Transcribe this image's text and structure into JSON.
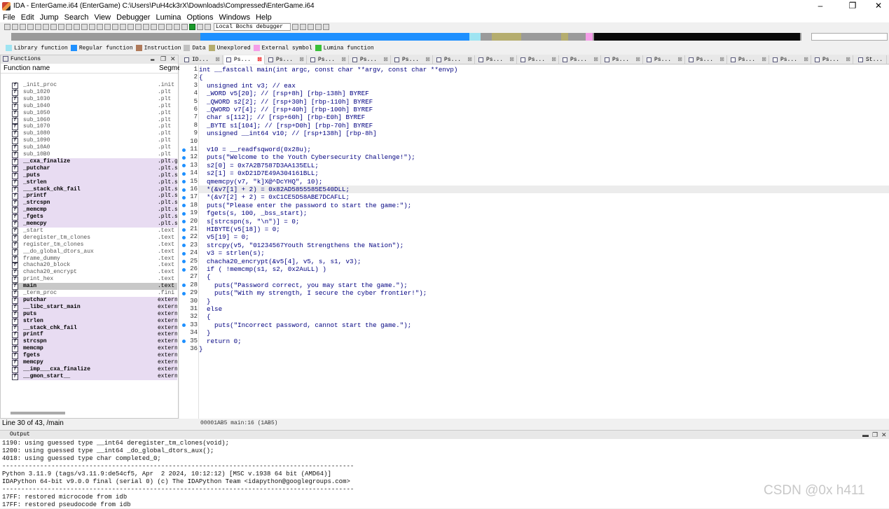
{
  "window": {
    "title": "IDA - EnterGame.i64 (EnterGame) C:\\Users\\PuH4ck3rX\\Downloads\\Compressed\\EnterGame.i64"
  },
  "menu": [
    "File",
    "Edit",
    "Jump",
    "Search",
    "View",
    "Debugger",
    "Lumina",
    "Options",
    "Windows",
    "Help"
  ],
  "toolbar": {
    "debugger": "Local Bochs debugger"
  },
  "legend": [
    {
      "label": "Library function",
      "color": "#9ee4f2"
    },
    {
      "label": "Regular function",
      "color": "#1e90ff"
    },
    {
      "label": "Instruction",
      "color": "#b07a5a"
    },
    {
      "label": "Data",
      "color": "#c0c0c0"
    },
    {
      "label": "Unexplored",
      "color": "#b5ad6e"
    },
    {
      "label": "External symbol",
      "color": "#f59ee8"
    },
    {
      "label": "Lumina function",
      "color": "#39c039"
    }
  ],
  "functions": {
    "title": "Functions",
    "col_name": "Function name",
    "col_segment": "Segme",
    "rows": [
      {
        "name": "_init_proc",
        "seg": ".init",
        "kind": "reg"
      },
      {
        "name": "sub_1020",
        "seg": ".plt",
        "kind": "reg"
      },
      {
        "name": "sub_1030",
        "seg": ".plt",
        "kind": "reg"
      },
      {
        "name": "sub_1040",
        "seg": ".plt",
        "kind": "reg"
      },
      {
        "name": "sub_1050",
        "seg": ".plt",
        "kind": "reg"
      },
      {
        "name": "sub_1060",
        "seg": ".plt",
        "kind": "reg"
      },
      {
        "name": "sub_1070",
        "seg": ".plt",
        "kind": "reg"
      },
      {
        "name": "sub_1080",
        "seg": ".plt",
        "kind": "reg"
      },
      {
        "name": "sub_1090",
        "seg": ".plt",
        "kind": "reg"
      },
      {
        "name": "sub_10A0",
        "seg": ".plt",
        "kind": "reg"
      },
      {
        "name": "sub_10B0",
        "seg": ".plt",
        "kind": "reg"
      },
      {
        "name": "__cxa_finalize",
        "seg": ".plt.g",
        "kind": "lib"
      },
      {
        "name": "_putchar",
        "seg": ".plt.s",
        "kind": "lib"
      },
      {
        "name": "_puts",
        "seg": ".plt.s",
        "kind": "lib"
      },
      {
        "name": "_strlen",
        "seg": ".plt.s",
        "kind": "lib"
      },
      {
        "name": "___stack_chk_fail",
        "seg": ".plt.s",
        "kind": "lib"
      },
      {
        "name": "_printf",
        "seg": ".plt.s",
        "kind": "lib"
      },
      {
        "name": "_strcspn",
        "seg": ".plt.s",
        "kind": "lib"
      },
      {
        "name": "_memcmp",
        "seg": ".plt.s",
        "kind": "lib"
      },
      {
        "name": "_fgets",
        "seg": ".plt.s",
        "kind": "lib"
      },
      {
        "name": "_memcpy",
        "seg": ".plt.s",
        "kind": "lib"
      },
      {
        "name": "_start",
        "seg": ".text",
        "kind": "reg"
      },
      {
        "name": "deregister_tm_clones",
        "seg": ".text",
        "kind": "reg"
      },
      {
        "name": "register_tm_clones",
        "seg": ".text",
        "kind": "reg"
      },
      {
        "name": "__do_global_dtors_aux",
        "seg": ".text",
        "kind": "reg"
      },
      {
        "name": "frame_dummy",
        "seg": ".text",
        "kind": "reg"
      },
      {
        "name": "chacha20_block",
        "seg": ".text",
        "kind": "reg"
      },
      {
        "name": "chacha20_encrypt",
        "seg": ".text",
        "kind": "reg"
      },
      {
        "name": "print_hex",
        "seg": ".text",
        "kind": "reg"
      },
      {
        "name": "main",
        "seg": ".text",
        "kind": "sel"
      },
      {
        "name": "_term_proc",
        "seg": ".fini",
        "kind": "reg"
      },
      {
        "name": "putchar",
        "seg": "extern",
        "kind": "lib"
      },
      {
        "name": "__libc_start_main",
        "seg": "extern",
        "kind": "lib"
      },
      {
        "name": "puts",
        "seg": "extern",
        "kind": "lib"
      },
      {
        "name": "strlen",
        "seg": "extern",
        "kind": "lib"
      },
      {
        "name": "__stack_chk_fail",
        "seg": "extern",
        "kind": "lib"
      },
      {
        "name": "printf",
        "seg": "extern",
        "kind": "lib"
      },
      {
        "name": "strcspn",
        "seg": "extern",
        "kind": "lib"
      },
      {
        "name": "memcmp",
        "seg": "extern",
        "kind": "lib"
      },
      {
        "name": "fgets",
        "seg": "extern",
        "kind": "lib"
      },
      {
        "name": "memcpy",
        "seg": "extern",
        "kind": "lib"
      },
      {
        "name": "__imp___cxa_finalize",
        "seg": "extern",
        "kind": "lib"
      },
      {
        "name": "__gmon_start__",
        "seg": "extern",
        "kind": "lib"
      }
    ],
    "status": "Line 30 of 43, /main"
  },
  "tabs": [
    "ID...",
    "Ps...",
    "Ps...",
    "Ps...",
    "Ps...",
    "Ps...",
    "Ps...",
    "Ps...",
    "Ps...",
    "Ps...",
    "Ps...",
    "Ps...",
    "Ps...",
    "Ps...",
    "Ps...",
    "Ps...",
    "St..."
  ],
  "code": [
    "int __fastcall main(int argc, const char **argv, const char **envp)",
    "{",
    "  unsigned int v3; // eax",
    "  _WORD v5[20]; // [rsp+8h] [rbp-138h] BYREF",
    "  _QWORD s2[2]; // [rsp+30h] [rbp-110h] BYREF",
    "  _QWORD v7[4]; // [rsp+40h] [rbp-100h] BYREF",
    "  char s[112]; // [rsp+60h] [rbp-E0h] BYREF",
    "  _BYTE s1[104]; // [rsp+D0h] [rbp-70h] BYREF",
    "  unsigned __int64 v10; // [rsp+138h] [rbp-8h]",
    "",
    "  v10 = __readfsqword(0x28u);",
    "  puts(\"Welcome to the Youth Cybersecurity Challenge!\");",
    "  s2[0] = 0x7A2B7587D3AA135ELL;",
    "  s2[1] = 0xD21D7E49A304161BLL;",
    "  qmemcpy(v7, \"k]X@^DcYHQ\", 10);",
    "  *(&v7[1] + 2) = 0x82AD5855585E540DLL;",
    "  *(&v7[2] + 2) = 0xC1CE5D58ABE7DCAFLL;",
    "  puts(\"Please enter the password to start the game:\");",
    "  fgets(s, 100, _bss_start);",
    "  s[strcspn(s, \"\\n\")] = 0;",
    "  HIBYTE(v5[18]) = 0;",
    "  v5[19] = 0;",
    "  strcpy(v5, \"01234567Youth Strengthens the Nation\");",
    "  v3 = strlen(s);",
    "  chacha20_encrypt(&v5[4], v5, s, s1, v3);",
    "  if ( !memcmp(s1, s2, 0x2AuLL) )",
    "  {",
    "    puts(\"Password correct, you may start the game.\");",
    "    puts(\"With my strength, I secure the cyber frontier!\");",
    "  }",
    "  else",
    "  {",
    "    puts(\"Incorrect password, cannot start the game.\");",
    "  }",
    "  return 0;",
    "}"
  ],
  "dotted_lines": [
    11,
    12,
    13,
    14,
    15,
    16,
    17,
    18,
    19,
    20,
    21,
    22,
    23,
    24,
    25,
    26,
    28,
    29,
    33,
    35
  ],
  "highlight_line": 16,
  "editor_status": "00001AB5 main:16 (1AB5)",
  "output": {
    "title": "Output",
    "lines": [
      "1190: using guessed type __int64 deregister_tm_clones(void);",
      "1200: using guessed type __int64 _do_global_dtors_aux();",
      "4018: using guessed type char completed_0;",
      "---------------------------------------------------------------------------------------------",
      "Python 3.11.9 (tags/v3.11.9:de54cf5, Apr  2 2024, 10:12:12) [MSC v.1938 64 bit (AMD64)]",
      "IDAPython 64-bit v9.0.0 final (serial 0) (c) The IDAPython Team <idapython@googlegroups.com>",
      "---------------------------------------------------------------------------------------------",
      "17FF: restored microcode from idb",
      "17FF: restored pseudocode from idb"
    ]
  },
  "watermark": "CSDN @0x h411"
}
